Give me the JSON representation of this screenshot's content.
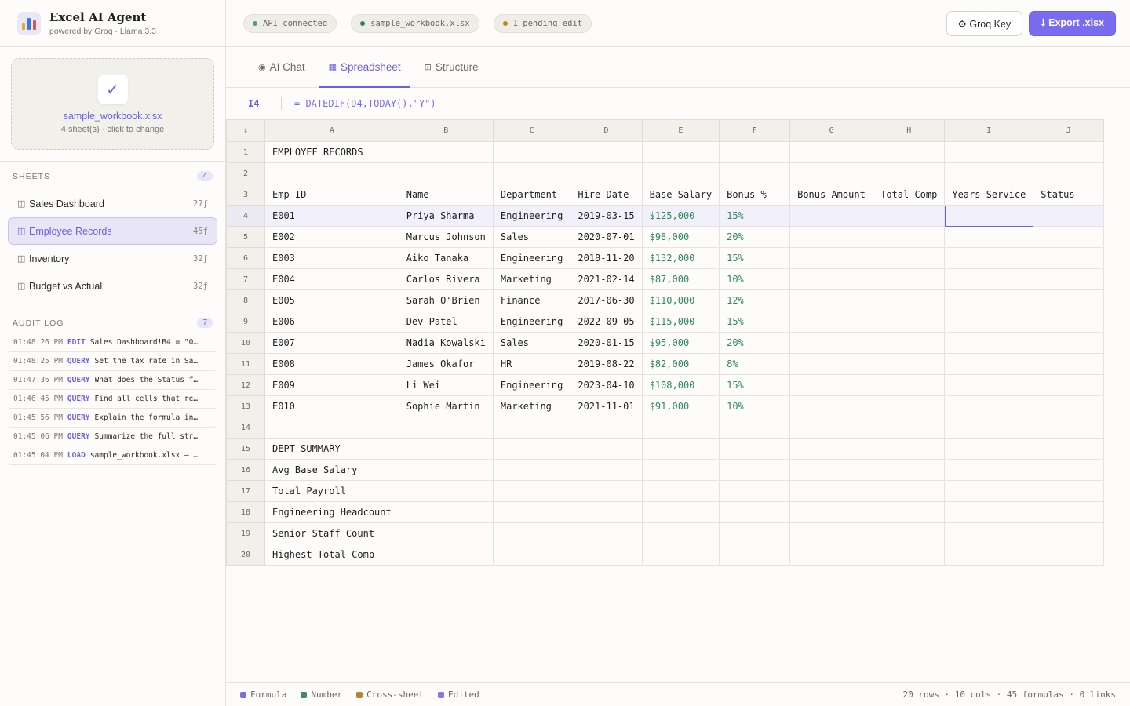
{
  "app": {
    "title": "Excel AI Agent",
    "subtitle": "powered by Groq · Llama 3.3"
  },
  "upload": {
    "check": "✓",
    "file_name": "sample_workbook.xlsx",
    "hint": "4 sheet(s) · click to change"
  },
  "sheets": {
    "label": "SHEETS",
    "count": "4",
    "items": [
      {
        "name": "Sales Dashboard",
        "meta": "27ƒ",
        "active": false
      },
      {
        "name": "Employee Records",
        "meta": "45ƒ",
        "active": true
      },
      {
        "name": "Inventory",
        "meta": "32ƒ",
        "active": false
      },
      {
        "name": "Budget vs Actual",
        "meta": "32ƒ",
        "active": false
      }
    ]
  },
  "audit": {
    "label": "AUDIT LOG",
    "count": "7",
    "items": [
      {
        "time": "01:48:26 PM",
        "type": "EDIT",
        "text": "Sales Dashboard!B4 = \"0…"
      },
      {
        "time": "01:48:25 PM",
        "type": "QUERY",
        "text": "Set the tax rate in Sa…"
      },
      {
        "time": "01:47:36 PM",
        "type": "QUERY",
        "text": "What does the Status f…"
      },
      {
        "time": "01:46:45 PM",
        "type": "QUERY",
        "text": "Find all cells that re…"
      },
      {
        "time": "01:45:56 PM",
        "type": "QUERY",
        "text": "Explain the formula in…"
      },
      {
        "time": "01:45:06 PM",
        "type": "QUERY",
        "text": "Summarize the full str…"
      },
      {
        "time": "01:45:04 PM",
        "type": "LOAD",
        "text": "sample_workbook.xlsx — …"
      }
    ]
  },
  "status_pills": [
    {
      "text": "API connected",
      "color": "#5e9a7a"
    },
    {
      "text": "sample_workbook.xlsx",
      "color": "#3d7a5c"
    },
    {
      "text": "1 pending edit",
      "color": "#b8862a"
    }
  ],
  "actions": {
    "groq_key": "⚙ Groq Key",
    "export": "🡓 Export .xlsx"
  },
  "tabs": [
    {
      "icon": "◉",
      "label": "AI Chat",
      "active": false
    },
    {
      "icon": "▦",
      "label": "Spreadsheet",
      "active": true
    },
    {
      "icon": "⊞",
      "label": "Structure",
      "active": false
    }
  ],
  "formula_bar": {
    "cell": "I4",
    "formula": "= DATEDIF(D4,TODAY(),\"Y\")"
  },
  "grid": {
    "corner": "↕",
    "columns": [
      "A",
      "B",
      "C",
      "D",
      "E",
      "F",
      "G",
      "H",
      "I",
      "J"
    ],
    "rows": [
      [
        "EMPLOYEE RECORDS",
        "",
        "",
        "",
        "",
        "",
        "",
        "",
        "",
        ""
      ],
      [
        "",
        "",
        "",
        "",
        "",
        "",
        "",
        "",
        "",
        ""
      ],
      [
        "Emp ID",
        "Name",
        "Department",
        "Hire Date",
        "Base Salary",
        "Bonus %",
        "Bonus Amount",
        "Total Comp",
        "Years Service",
        "Status"
      ],
      [
        "E001",
        "Priya Sharma",
        "Engineering",
        "2019-03-15",
        "$125,000",
        "15%",
        "",
        "",
        "",
        ""
      ],
      [
        "E002",
        "Marcus Johnson",
        "Sales",
        "2020-07-01",
        "$98,000",
        "20%",
        "",
        "",
        "",
        ""
      ],
      [
        "E003",
        "Aiko Tanaka",
        "Engineering",
        "2018-11-20",
        "$132,000",
        "15%",
        "",
        "",
        "",
        ""
      ],
      [
        "E004",
        "Carlos Rivera",
        "Marketing",
        "2021-02-14",
        "$87,000",
        "10%",
        "",
        "",
        "",
        ""
      ],
      [
        "E005",
        "Sarah O'Brien",
        "Finance",
        "2017-06-30",
        "$110,000",
        "12%",
        "",
        "",
        "",
        ""
      ],
      [
        "E006",
        "Dev Patel",
        "Engineering",
        "2022-09-05",
        "$115,000",
        "15%",
        "",
        "",
        "",
        ""
      ],
      [
        "E007",
        "Nadia Kowalski",
        "Sales",
        "2020-01-15",
        "$95,000",
        "20%",
        "",
        "",
        "",
        ""
      ],
      [
        "E008",
        "James Okafor",
        "HR",
        "2019-08-22",
        "$82,000",
        "8%",
        "",
        "",
        "",
        ""
      ],
      [
        "E009",
        "Li Wei",
        "Engineering",
        "2023-04-10",
        "$108,000",
        "15%",
        "",
        "",
        "",
        ""
      ],
      [
        "E010",
        "Sophie Martin",
        "Marketing",
        "2021-11-01",
        "$91,000",
        "10%",
        "",
        "",
        "",
        ""
      ],
      [
        "",
        "",
        "",
        "",
        "",
        "",
        "",
        "",
        "",
        ""
      ],
      [
        "DEPT SUMMARY",
        "",
        "",
        "",
        "",
        "",
        "",
        "",
        "",
        ""
      ],
      [
        "Avg Base Salary",
        "",
        "",
        "",
        "",
        "",
        "",
        "",
        "",
        ""
      ],
      [
        "Total Payroll",
        "",
        "",
        "",
        "",
        "",
        "",
        "",
        "",
        ""
      ],
      [
        "Engineering Headcount",
        "",
        "",
        "",
        "",
        "",
        "",
        "",
        "",
        ""
      ],
      [
        "Senior Staff Count",
        "",
        "",
        "",
        "",
        "",
        "",
        "",
        "",
        ""
      ],
      [
        "Highest Total Comp",
        "",
        "",
        "",
        "",
        "",
        "",
        "",
        "",
        ""
      ]
    ],
    "selected": {
      "row": 4,
      "col": "I"
    }
  },
  "footer": {
    "legend": [
      {
        "label": "Formula",
        "color": "#7a6cf0"
      },
      {
        "label": "Number",
        "color": "#3d8a64"
      },
      {
        "label": "Cross-sheet",
        "color": "#b8862a"
      },
      {
        "label": "Edited",
        "color": "#8a72e8"
      }
    ],
    "stats": "20 rows · 10 cols · 45 formulas · 0 links"
  }
}
